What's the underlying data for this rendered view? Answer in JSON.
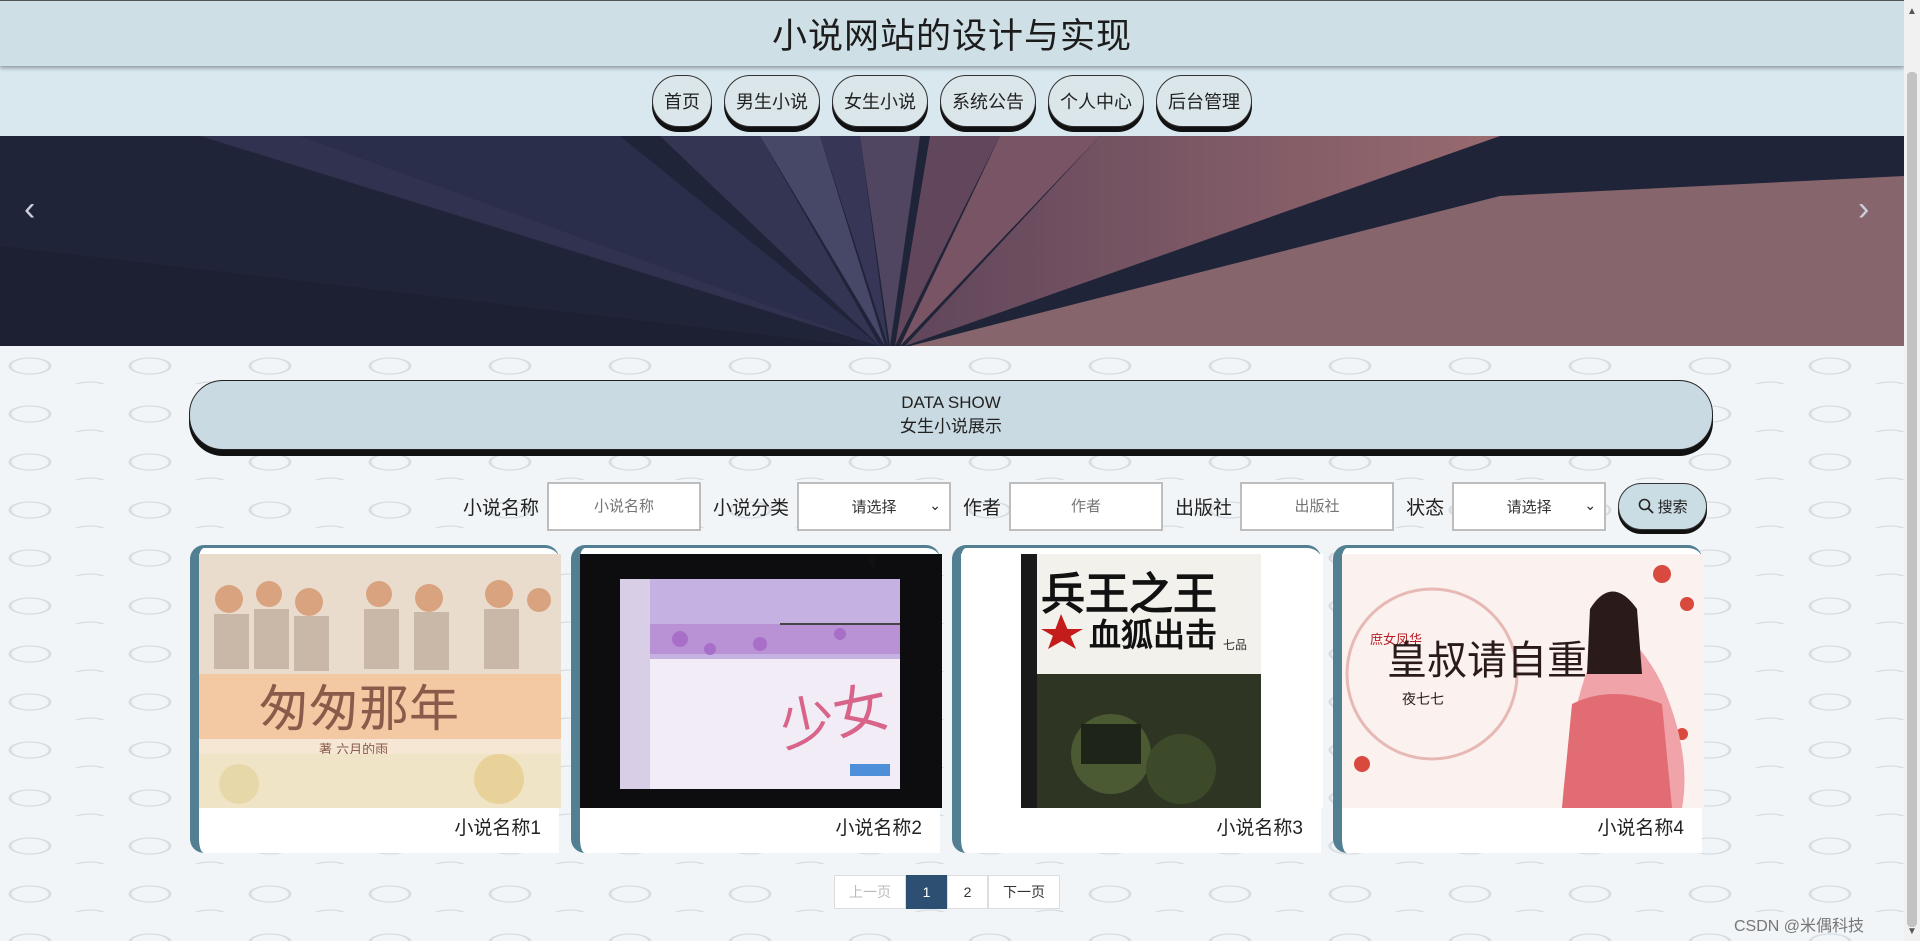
{
  "site": {
    "title": "小说网站的设计与实现"
  },
  "nav": {
    "items": [
      {
        "label": "首页"
      },
      {
        "label": "男生小说"
      },
      {
        "label": "女生小说"
      },
      {
        "label": "系统公告"
      },
      {
        "label": "个人中心"
      },
      {
        "label": "后台管理"
      }
    ]
  },
  "banner": {
    "prev": "‹",
    "next": "›"
  },
  "section": {
    "title_en": "DATA SHOW",
    "title_cn": "女生小说展示"
  },
  "search": {
    "name_label": "小说名称",
    "name_placeholder": "小说名称",
    "category_label": "小说分类",
    "category_value": "请选择",
    "author_label": "作者",
    "author_placeholder": "作者",
    "publisher_label": "出版社",
    "publisher_placeholder": "出版社",
    "status_label": "状态",
    "status_value": "请选择",
    "button_label": "搜索",
    "button_icon": "search-icon"
  },
  "novels": [
    {
      "name": "小说名称1",
      "cover_title": "匆匆那年",
      "cover_author": "著 六月的雨"
    },
    {
      "name": "小说名称2",
      "cover_title": "少女"
    },
    {
      "name": "小说名称3",
      "cover_title": "兵王之王",
      "cover_subtitle": "血狐出击",
      "cover_author": "七品"
    },
    {
      "name": "小说名称4",
      "cover_title": "皇叔请自重",
      "cover_author": "夜七七",
      "cover_tag": "庶女凤华"
    }
  ],
  "pagination": {
    "prev": "上一页",
    "pages": [
      "1",
      "2"
    ],
    "current": "1",
    "next": "下一页"
  },
  "watermark": "CSDN @米偶科技",
  "colors": {
    "header_bg": "#cfdfe6",
    "nav_bg": "#d9e7ef",
    "card_border": "#527f91",
    "page_active": "#2d4f72"
  }
}
